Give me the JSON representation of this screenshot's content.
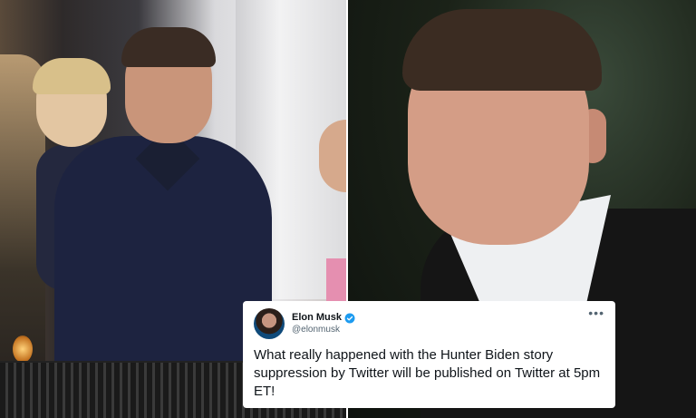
{
  "tweet": {
    "name": "Elon Musk",
    "handle": "@elonmusk",
    "text": "What really happened with the Hunter Biden story suppression by Twitter will be published on Twitter at 5pm ET!",
    "verified": true,
    "more_icon": "ellipsis-icon",
    "more_label": "•••"
  },
  "colors": {
    "verified_badge": "#1d9bf0",
    "tweet_text": "#0f1419",
    "tweet_secondary": "#536471",
    "card_background": "#ffffff"
  }
}
